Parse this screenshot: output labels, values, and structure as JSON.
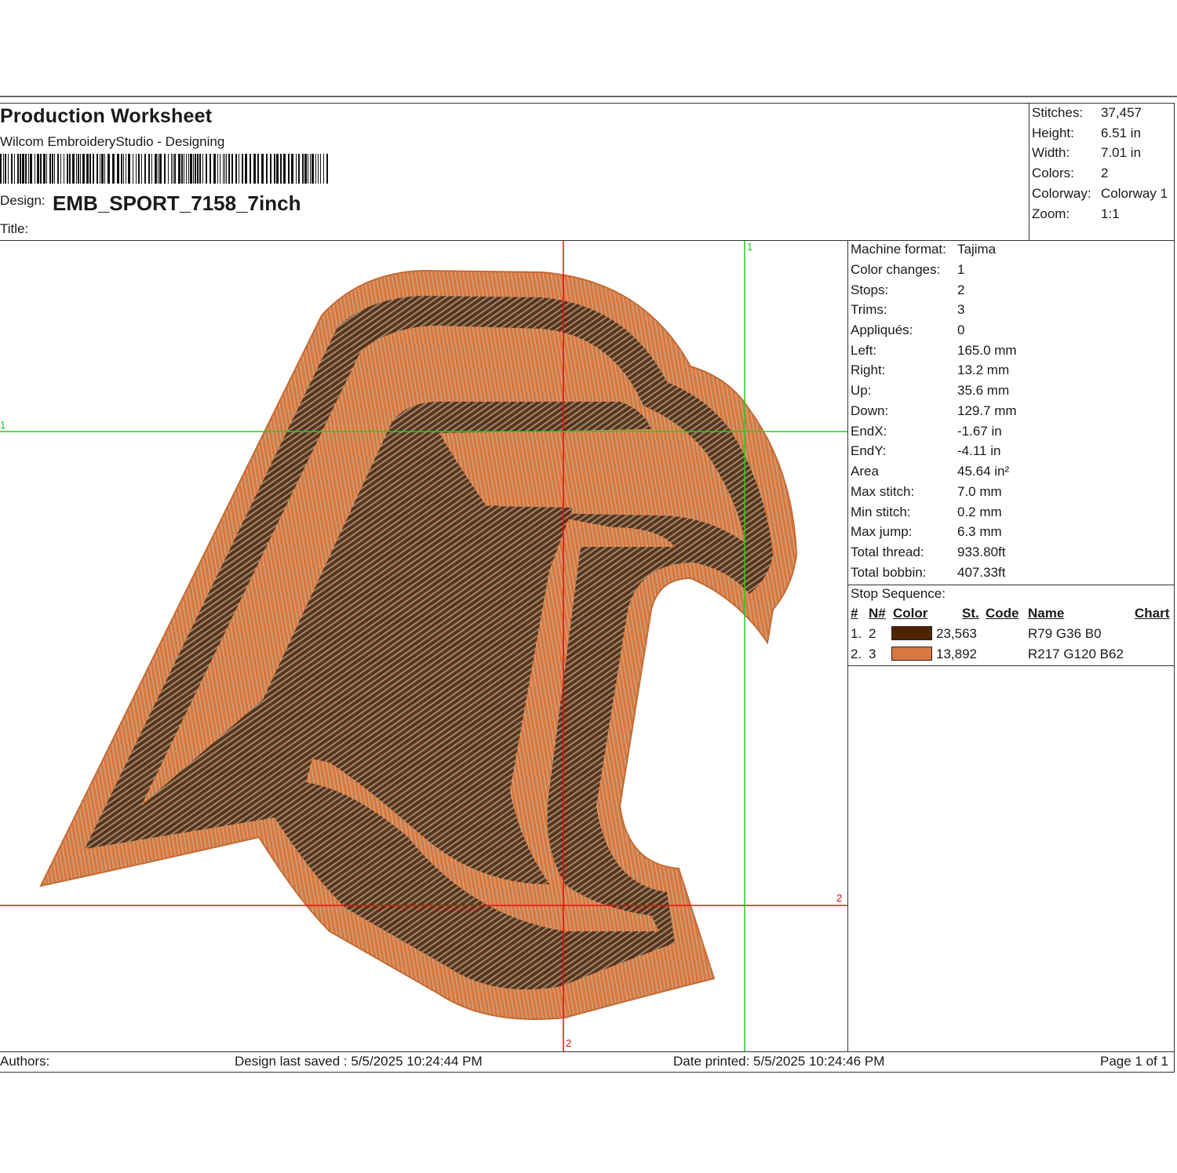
{
  "header": {
    "title": "Production Worksheet",
    "software": "Wilcom EmbroideryStudio - Designing",
    "design_label": "Design:",
    "design_name": "EMB_SPORT_7158_7inch",
    "title_label": "Title:"
  },
  "stats": [
    {
      "label": "Stitches:",
      "value": "37,457"
    },
    {
      "label": "Height:",
      "value": "6.51 in"
    },
    {
      "label": "Width:",
      "value": "7.01 in"
    },
    {
      "label": "Colors:",
      "value": "2"
    },
    {
      "label": "Colorway:",
      "value": "Colorway 1"
    },
    {
      "label": "Zoom:",
      "value": "1:1"
    }
  ],
  "machine_info": [
    {
      "label": "Machine format:",
      "value": "Tajima"
    },
    {
      "label": "Color changes:",
      "value": "1"
    },
    {
      "label": "Stops:",
      "value": "2"
    },
    {
      "label": "Trims:",
      "value": "3"
    },
    {
      "label": "Appliqués:",
      "value": "0"
    },
    {
      "label": "Left:",
      "value": "165.0 mm"
    },
    {
      "label": "Right:",
      "value": "13.2 mm"
    },
    {
      "label": "Up:",
      "value": "35.6 mm"
    },
    {
      "label": "Down:",
      "value": "129.7 mm"
    },
    {
      "label": "EndX:",
      "value": "-1.67 in"
    },
    {
      "label": "EndY:",
      "value": "-4.11 in"
    },
    {
      "label": "Area",
      "value": " 45.64 in²"
    },
    {
      "label": "Max stitch:",
      "value": "7.0 mm"
    },
    {
      "label": "Min stitch:",
      "value": "0.2 mm"
    },
    {
      "label": "Max jump:",
      "value": "6.3 mm"
    },
    {
      "label": "Total thread:",
      "value": "933.80ft"
    },
    {
      "label": "Total bobbin:",
      "value": "407.33ft"
    }
  ],
  "stop_sequence": {
    "title": "Stop Sequence:",
    "headers": {
      "num": "#",
      "n": "N#",
      "color": "Color",
      "st": "St.",
      "code": "Code",
      "name": "Name",
      "chart": "Chart"
    },
    "rows": [
      {
        "num": "1.",
        "n": "2",
        "color": "#4F2400",
        "stitches": "23,563",
        "name": "R79 G36 B0"
      },
      {
        "num": "2.",
        "n": "3",
        "color": "#D9783E",
        "stitches": "13,892",
        "name": "R217 G120 B62"
      }
    ]
  },
  "guides": {
    "markers": [
      "1",
      "1",
      "2",
      "2"
    ]
  },
  "footer": {
    "authors": "Authors:",
    "saved": "Design last saved : 5/5/2025 10:24:44 PM",
    "printed": "Date printed: 5/5/2025 10:24:46 PM",
    "page": "Page 1 of 1"
  },
  "colors": {
    "brown": "#4F2400",
    "orange": "#D9783E",
    "guide_red": "#e01010",
    "guide_green": "#22cc22"
  }
}
